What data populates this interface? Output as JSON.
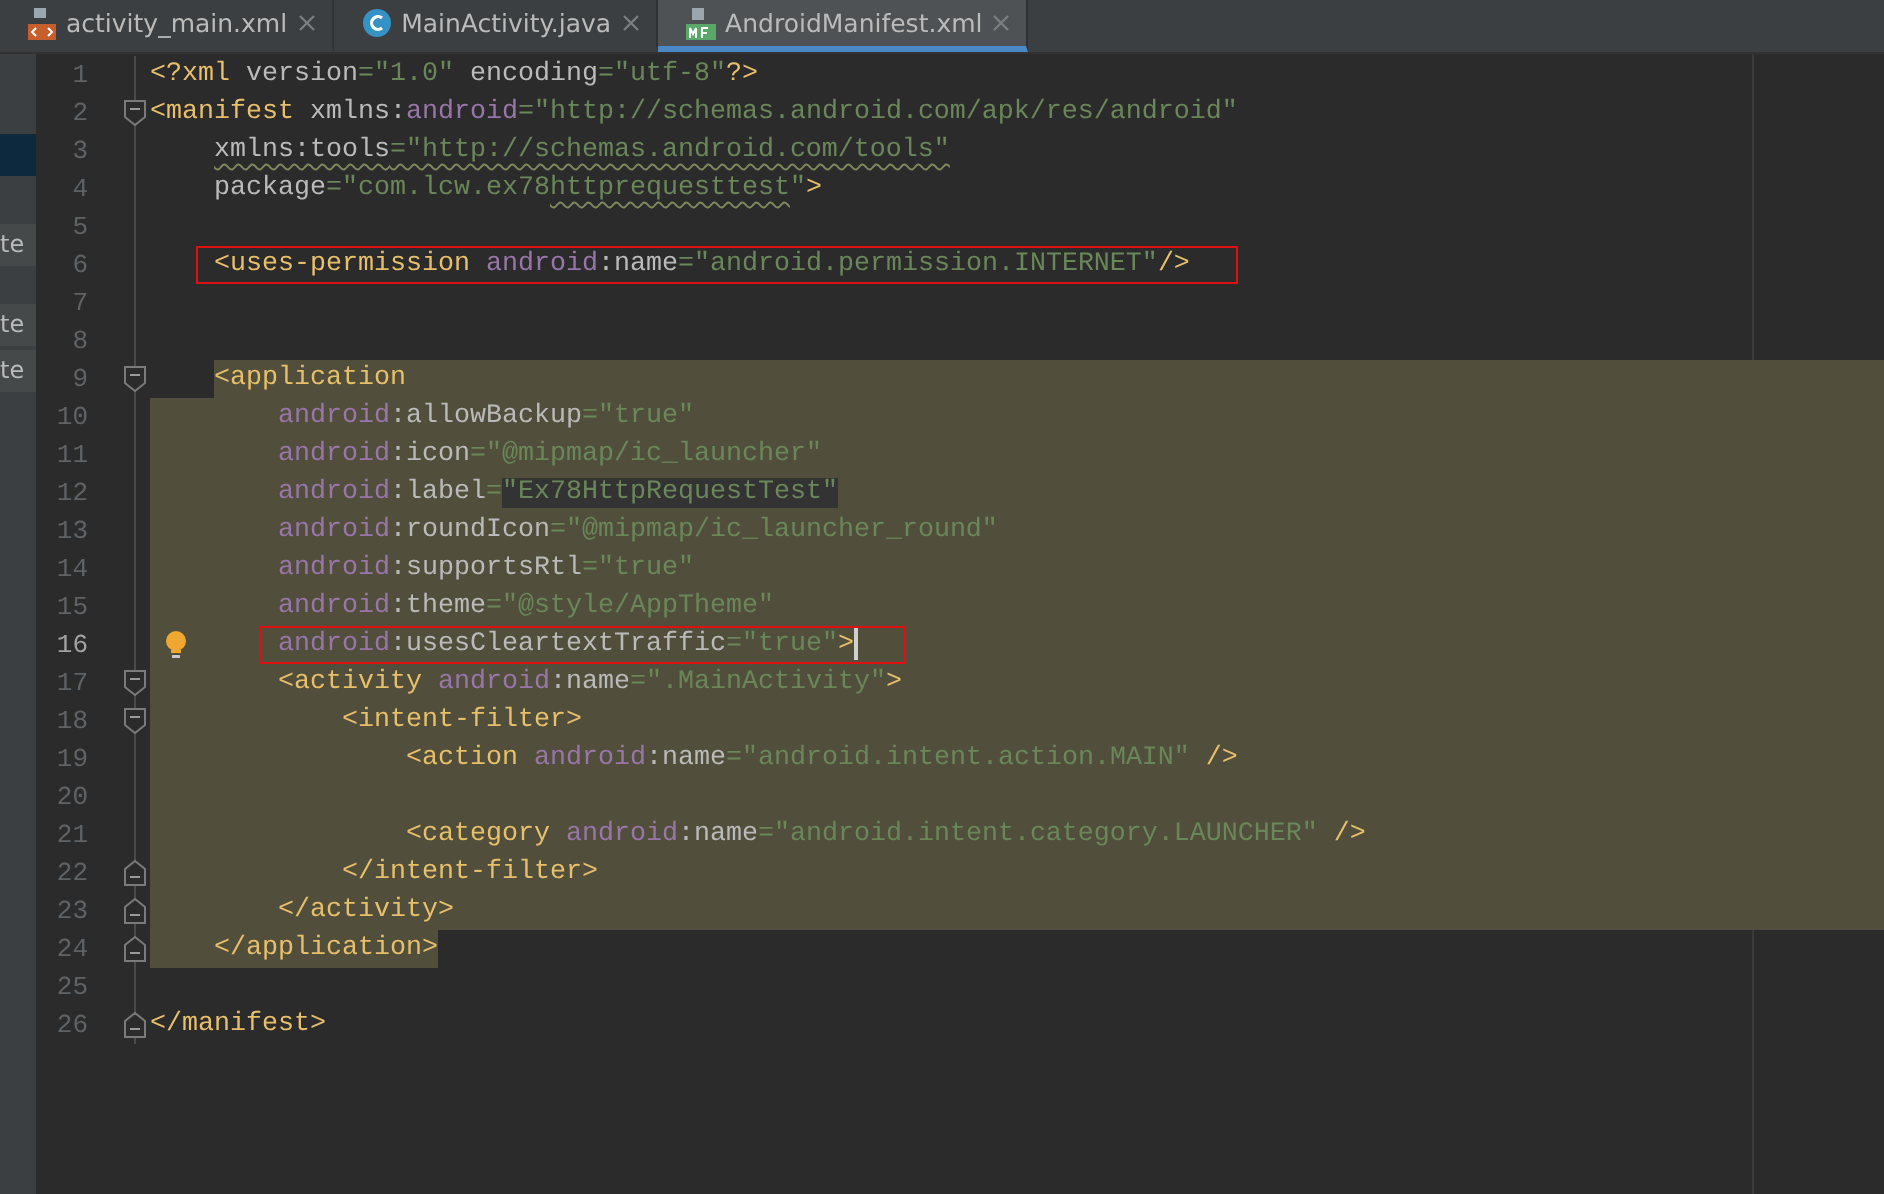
{
  "tabs": [
    {
      "label": "activity_main.xml",
      "selected": false
    },
    {
      "label": "MainActivity.java",
      "selected": false
    },
    {
      "label": "AndroidManifest.xml",
      "selected": true
    }
  ],
  "side_panel": {
    "items": [
      {
        "selected": true
      },
      {
        "text": "te",
        "selected": false
      },
      {
        "text": "te",
        "selected": false
      },
      {
        "text": "te",
        "selected": false
      }
    ]
  },
  "editor": {
    "lines": [
      {
        "number": "1",
        "selected": false,
        "tokens": [
          {
            "kind": "tag",
            "text": "<?xml"
          },
          {
            "kind": "attr",
            "text": " version"
          },
          {
            "kind": "value",
            "text": "=\"1.0\""
          },
          {
            "kind": "attr",
            "text": " encoding"
          },
          {
            "kind": "value",
            "text": "=\"utf-8\""
          },
          {
            "kind": "tag",
            "text": "?>"
          }
        ]
      },
      {
        "number": "2",
        "selected": false,
        "fold_start": true,
        "tokens": [
          {
            "kind": "tag",
            "text": "<manifest"
          },
          {
            "kind": "attr",
            "text": " xmlns:"
          },
          {
            "kind": "ns",
            "text": "android"
          },
          {
            "kind": "value",
            "text": "=\"http://schemas.android.com/apk/res/android\""
          }
        ],
        "children": [
          {
            "number": "3",
            "selected": false,
            "tokens": [
              {
                "kind": "attr",
                "text": "xmlns:tools",
                "typo": true
              },
              {
                "kind": "value",
                "text": "=\"http://schemas.android.com/tools\"",
                "typo": true
              }
            ]
          },
          {
            "number": "4",
            "selected": false,
            "tokens": [
              {
                "kind": "attr",
                "text": "package"
              },
              {
                "kind": "value",
                "text": "=\"com.lcw.ex78"
              },
              {
                "kind": "value",
                "text": "httprequesttest",
                "typo": true
              },
              {
                "kind": "value",
                "text": "\""
              },
              {
                "kind": "tag",
                "text": ">"
              }
            ]
          },
          {
            "number": "5",
            "selected": false
          },
          {
            "number": "6",
            "selected": false,
            "boxed": true,
            "tokens": [
              {
                "kind": "tag",
                "text": "<uses-permission"
              },
              {
                "kind": "ns",
                "text": " android"
              },
              {
                "kind": "attr",
                "text": ":name"
              },
              {
                "kind": "value",
                "text": "=\"android.permission.INTERNET\""
              },
              {
                "kind": "tag",
                "text": "/>"
              }
            ]
          },
          {
            "number": "7",
            "selected": false
          },
          {
            "number": "8",
            "selected": false
          },
          {
            "number": "9",
            "selected": true,
            "selection_start": true,
            "fold_start": true,
            "tokens": [
              {
                "kind": "tag",
                "text": "<application"
              }
            ],
            "children": [
              {
                "number": "10",
                "selected": true,
                "tokens": [
                  {
                    "kind": "ns",
                    "text": "android"
                  },
                  {
                    "kind": "attr",
                    "text": ":allowBackup"
                  },
                  {
                    "kind": "value",
                    "text": "=\"true\""
                  }
                ]
              },
              {
                "number": "11",
                "selected": true,
                "tokens": [
                  {
                    "kind": "ns",
                    "text": "android"
                  },
                  {
                    "kind": "attr",
                    "text": ":icon"
                  },
                  {
                    "kind": "value",
                    "text": "=\"@mipmap/ic_launcher\""
                  }
                ]
              },
              {
                "number": "12",
                "selected": true,
                "tokens": [
                  {
                    "kind": "ns",
                    "text": "android"
                  },
                  {
                    "kind": "attr",
                    "text": ":label"
                  },
                  {
                    "kind": "value",
                    "text": "="
                  },
                  {
                    "kind": "value",
                    "text": "\"Ex78HttpRequestTest\"",
                    "highlighted": true
                  }
                ]
              },
              {
                "number": "13",
                "selected": true,
                "tokens": [
                  {
                    "kind": "ns",
                    "text": "android"
                  },
                  {
                    "kind": "attr",
                    "text": ":roundIcon"
                  },
                  {
                    "kind": "value",
                    "text": "=\"@mipmap/ic_launcher_round\""
                  }
                ]
              },
              {
                "number": "14",
                "selected": true,
                "tokens": [
                  {
                    "kind": "ns",
                    "text": "android"
                  },
                  {
                    "kind": "attr",
                    "text": ":supportsRtl"
                  },
                  {
                    "kind": "value",
                    "text": "=\"true\""
                  }
                ]
              },
              {
                "number": "15",
                "selected": true,
                "tokens": [
                  {
                    "kind": "ns",
                    "text": "android"
                  },
                  {
                    "kind": "attr",
                    "text": ":theme"
                  },
                  {
                    "kind": "value",
                    "text": "=\"@style/AppTheme\""
                  }
                ]
              },
              {
                "number": "16",
                "selected": true,
                "current": true,
                "hint": true,
                "caret": true,
                "boxed": true,
                "tokens": [
                  {
                    "kind": "ns",
                    "text": "android"
                  },
                  {
                    "kind": "attr",
                    "text": ":usesCleartextTraffic"
                  },
                  {
                    "kind": "value",
                    "text": "=\"true\""
                  },
                  {
                    "kind": "tag",
                    "text": ">"
                  }
                ]
              },
              {
                "number": "17",
                "selected": true,
                "fold_start": true,
                "tokens": [
                  {
                    "kind": "tag",
                    "text": "<activity"
                  },
                  {
                    "kind": "ns",
                    "text": " android"
                  },
                  {
                    "kind": "attr",
                    "text": ":name"
                  },
                  {
                    "kind": "value",
                    "text": "=\".MainActivity\""
                  },
                  {
                    "kind": "tag",
                    "text": ">"
                  }
                ],
                "children": [
                  {
                    "number": "18",
                    "selected": true,
                    "fold_start": true,
                    "tokens": [
                      {
                        "kind": "tag",
                        "text": "<intent-filter>"
                      }
                    ],
                    "children": [
                      {
                        "number": "19",
                        "selected": true,
                        "tokens": [
                          {
                            "kind": "tag",
                            "text": "<action"
                          },
                          {
                            "kind": "ns",
                            "text": " android"
                          },
                          {
                            "kind": "attr",
                            "text": ":name"
                          },
                          {
                            "kind": "value",
                            "text": "=\"android.intent.action.MAIN\""
                          },
                          {
                            "kind": "tag",
                            "text": " />"
                          }
                        ]
                      },
                      {
                        "number": "20",
                        "selected": true
                      },
                      {
                        "number": "21",
                        "selected": true,
                        "tokens": [
                          {
                            "kind": "tag",
                            "text": "<category"
                          },
                          {
                            "kind": "ns",
                            "text": " android"
                          },
                          {
                            "kind": "attr",
                            "text": ":name"
                          },
                          {
                            "kind": "value",
                            "text": "=\"android.intent.category.LAUNCHER\""
                          },
                          {
                            "kind": "tag",
                            "text": " />"
                          }
                        ]
                      }
                    ]
                  },
                  {
                    "number": "22",
                    "selected": true,
                    "fold_end": true,
                    "tokens": [
                      {
                        "kind": "tag",
                        "text": "</intent-filter>"
                      }
                    ]
                  }
                ]
              },
              {
                "number": "23",
                "selected": true,
                "fold_end": true,
                "tokens": [
                  {
                    "kind": "tag",
                    "text": "</activity>"
                  }
                ]
              }
            ]
          },
          {
            "number": "24",
            "selected": true,
            "selection_end": true,
            "fold_end": true,
            "tokens": [
              {
                "kind": "tag",
                "text": "</application>"
              }
            ]
          },
          {
            "number": "25",
            "selected": false
          }
        ]
      },
      {
        "number": "26",
        "selected": false,
        "fold_end": true,
        "tokens": [
          {
            "kind": "tag",
            "text": "</manifest>"
          }
        ]
      }
    ]
  }
}
